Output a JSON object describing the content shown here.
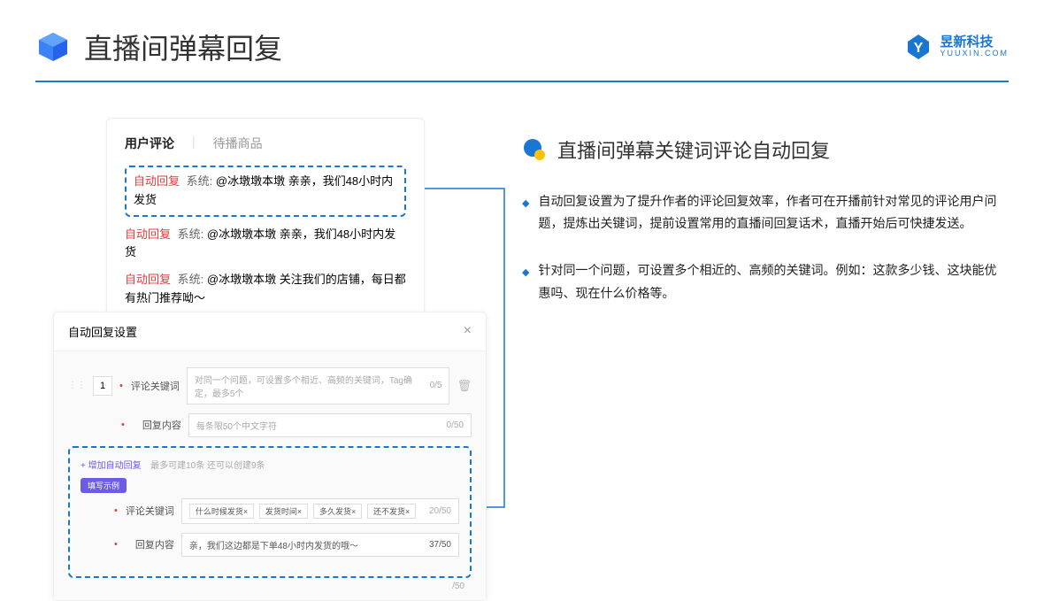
{
  "header": {
    "title": "直播间弹幕回复",
    "logo_cn": "昱新科技",
    "logo_en": "YUUXIN.COM"
  },
  "comment_panel": {
    "tab_active": "用户评论",
    "tab_inactive": "待播商品",
    "row1": {
      "label": "自动回复",
      "sys": "系统:",
      "text": "@冰墩墩本墩 亲亲，我们48小时内发货"
    },
    "row2": {
      "label": "自动回复",
      "sys": "系统:",
      "text": "@冰墩墩本墩 亲亲，我们48小时内发货"
    },
    "row3": {
      "label": "自动回复",
      "sys": "系统:",
      "text": "@冰墩墩本墩 关注我们的店铺，每日都有热门推荐呦～"
    }
  },
  "settings": {
    "title": "自动回复设置",
    "index": "1",
    "kw_label": "评论关键词",
    "kw_placeholder": "对同一个问题，可设置多个相近、高频的关键词，Tag确定，最多5个",
    "kw_count": "0/5",
    "content_label": "回复内容",
    "content_placeholder": "每条限50个中文字符",
    "content_count": "0/50",
    "add_link": "+ 增加自动回复",
    "add_hint": "最多可建10条 还可以创建9条",
    "example_badge": "填写示例",
    "example_kw_label": "评论关键词",
    "tags": [
      "什么时候发货×",
      "发货时间×",
      "多久发货×",
      "还不发货×"
    ],
    "tag_count": "20/50",
    "example_content_label": "回复内容",
    "example_content_text": "亲，我们这边都是下单48小时内发货的哦～",
    "example_content_count": "37/50",
    "bottom_count": "/50"
  },
  "right": {
    "section_title": "直播间弹幕关键词评论自动回复",
    "bullet1": "自动回复设置为了提升作者的评论回复效率，作者可在开播前针对常见的评论用户问题，提炼出关键词，提前设置常用的直播间回复话术，直播开始后可快捷发送。",
    "bullet2": "针对同一个问题，可设置多个相近的、高频的关键词。例如：这款多少钱、这块能优惠吗、现在什么价格等。"
  }
}
